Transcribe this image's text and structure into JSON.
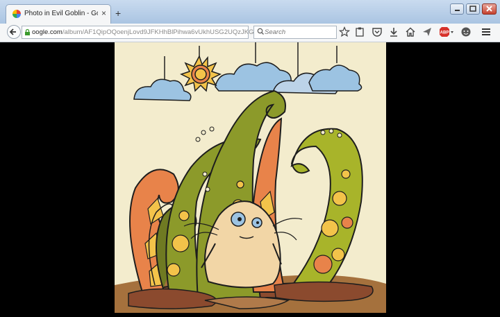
{
  "tab": {
    "title": "Photo in Evil Goblin - Goo…",
    "close": "×",
    "new_tab": "+"
  },
  "toolbar": {
    "url_domain": "oogle.com",
    "url_path": "/album/AF1QipOQoenjLovd9JFKHhBlPihwa6vUkhUSG2UQzJKG",
    "reload": "⟳",
    "search_placeholder": "Search"
  },
  "photo": {
    "description": "Illustration of an evil goblin among swirling tentacle-like plants"
  },
  "colors": {
    "bg": "#000000",
    "paper": "#f3eccd",
    "olive": "#8c9a2a",
    "orange": "#e8834a",
    "yellow": "#f3c34a",
    "skin": "#f2d6a6",
    "sky": "#9cc3e2"
  }
}
